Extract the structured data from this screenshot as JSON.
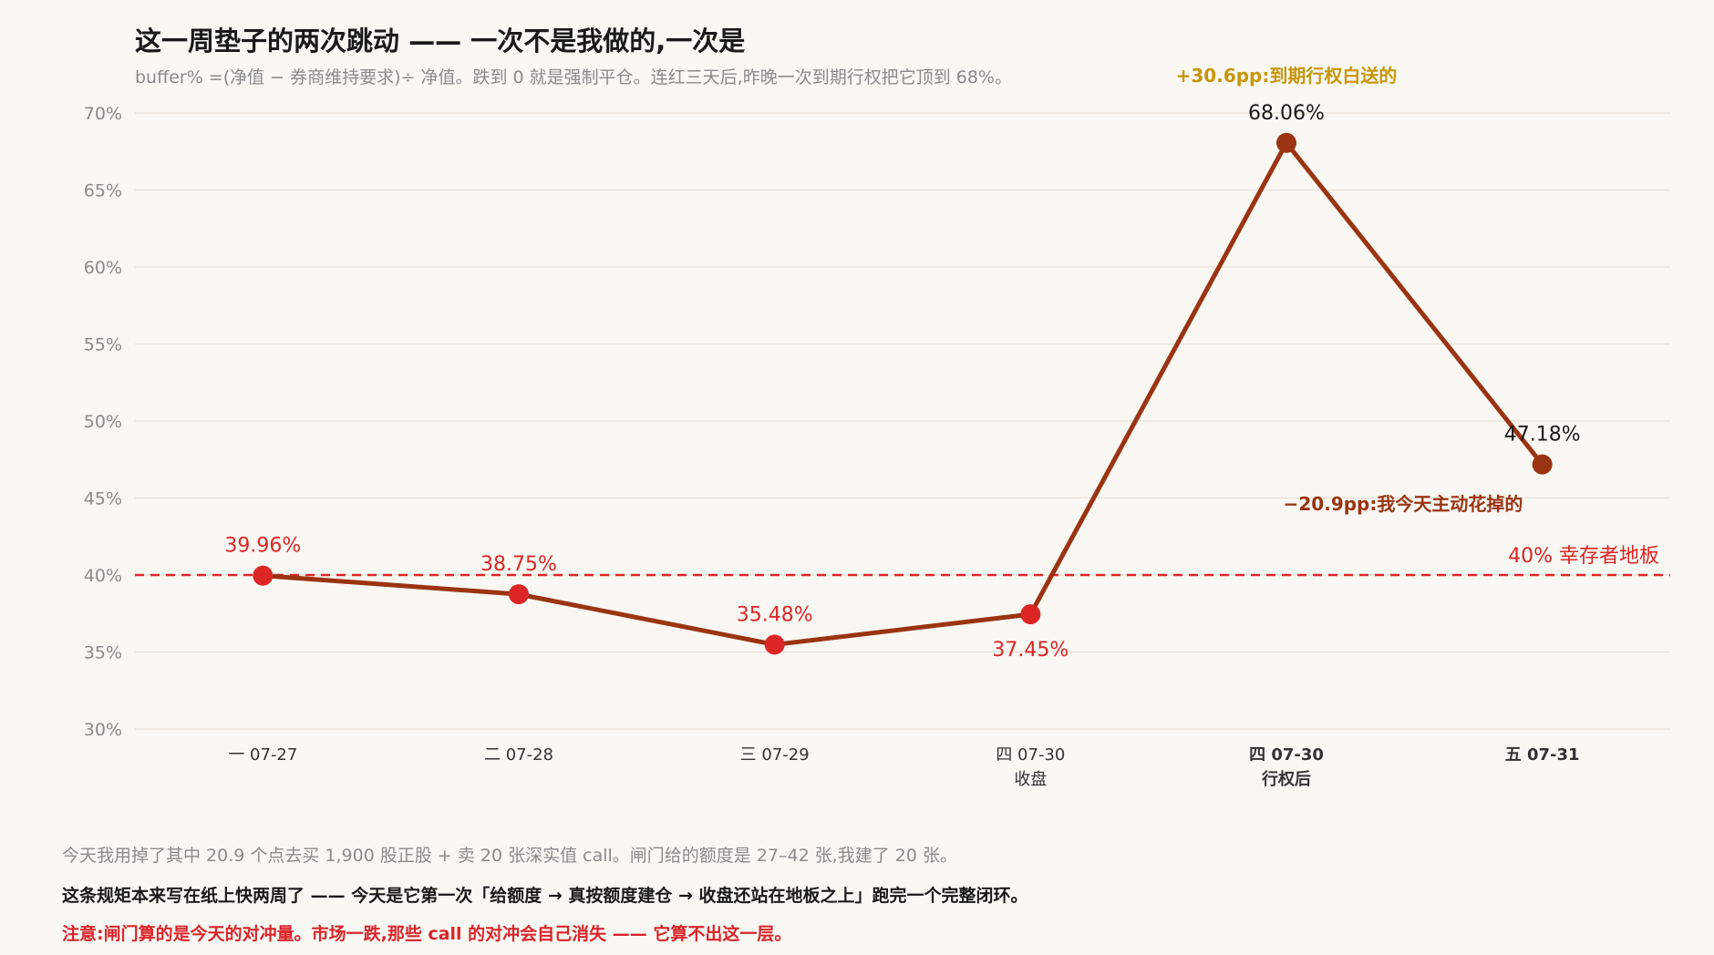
{
  "title": "这一周垫子的两次跳动 —— 一次不是我做的,一次是",
  "subtitle": "buffer% =(净值 − 券商维持要求)÷ 净值。跌到 0 就是强制平仓。连红三天后,昨晚一次到期行权把它顶到 68%。",
  "colors": {
    "line": "#9a3412",
    "point_red": "#dc2626",
    "point_brown": "#9a3412",
    "threshold": "#dc2626",
    "annotation_gold": "#c8960c",
    "text_dark": "#1a1a1a",
    "text_gray": "#8a8a8a"
  },
  "chart_data": {
    "type": "line",
    "x": [
      "一 07-27",
      "二 07-28",
      "三 07-29",
      "四 07-30 收盘",
      "四 07-30 行权后",
      "五 07-31"
    ],
    "x_tick_lines": [
      [
        "一 07-27"
      ],
      [
        "二 07-28"
      ],
      [
        "三 07-29"
      ],
      [
        "四 07-30",
        "收盘"
      ],
      [
        "四 07-30",
        "行权后"
      ],
      [
        "五 07-31"
      ]
    ],
    "x_tick_bold": [
      false,
      false,
      false,
      false,
      true,
      true
    ],
    "series": [
      {
        "values": [
          39.96,
          38.75,
          35.48,
          37.45,
          68.06,
          47.18
        ],
        "point_colors": [
          "#dc2626",
          "#dc2626",
          "#dc2626",
          "#dc2626",
          "#9a3412",
          "#9a3412"
        ],
        "labels": [
          "39.96%",
          "38.75%",
          "35.48%",
          "37.45%",
          "68.06%",
          "47.18%"
        ],
        "label_colors": [
          "#dc2626",
          "#dc2626",
          "#dc2626",
          "#dc2626",
          "#1a1a1a",
          "#1a1a1a"
        ],
        "label_position": [
          "above",
          "above",
          "above",
          "below",
          "above",
          "above"
        ]
      }
    ],
    "ylim": [
      30,
      70
    ],
    "yticks": [
      30,
      35,
      40,
      45,
      50,
      55,
      60,
      65,
      70
    ],
    "ytick_labels": [
      "30%",
      "35%",
      "40%",
      "45%",
      "50%",
      "55%",
      "60%",
      "65%",
      "70%"
    ],
    "grid": true,
    "threshold": {
      "value": 40,
      "label": "40% 幸存者地板"
    },
    "annotations": [
      {
        "text": "+30.6pp:到期行权白送的",
        "color": "#c8960c"
      },
      {
        "text": "−20.9pp:我今天主动花掉的",
        "color": "#9a3412"
      }
    ]
  },
  "notes": [
    "今天我用掉了其中 20.9 个点去买 1,900 股正股 + 卖 20 张深实值 call。闸门给的额度是 27–42 张,我建了 20 张。",
    "这条规矩本来写在纸上快两周了 —— 今天是它第一次「给额度 → 真按额度建仓 → 收盘还站在地板之上」跑完一个完整闭环。",
    "注意:闸门算的是今天的对冲量。市场一跌,那些 call 的对冲会自己消失 —— 它算不出这一层。"
  ]
}
